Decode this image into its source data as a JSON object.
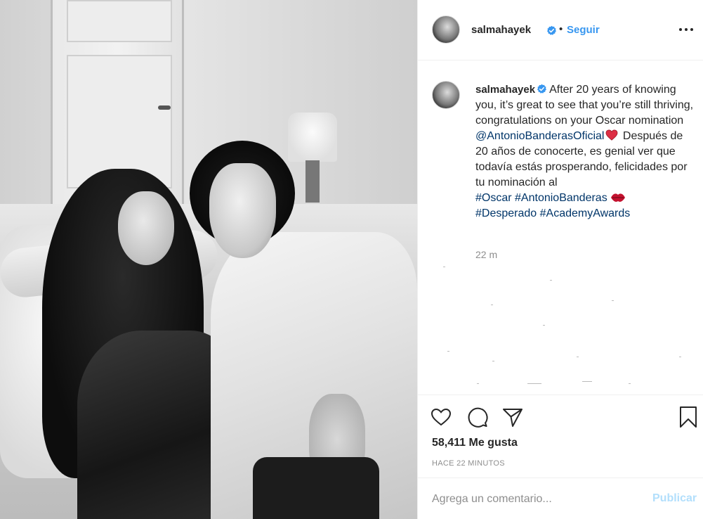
{
  "post": {
    "username": "salmahayek",
    "dot_separator": "•",
    "follow_label": "Seguir",
    "caption": {
      "username": "salmahayek",
      "text_1": "After 20 years of knowing you, it’s great to see that you’re still thriving, congratulations on your Oscar nomination",
      "mention": "@AntonioBanderasOficial",
      "text_2": "Después de 20 años de conocerte, es genial ver que todavía estás prosperando, felicidades por tu nominación al",
      "hashtags_line1": [
        "#Oscar",
        "#AntonioBanderas"
      ],
      "hashtags_line2": [
        "#Desperado",
        "#AcademyAwards"
      ],
      "emoji_1": "red-heart",
      "emoji_2": "kiss-mark"
    },
    "caption_time": "22 m",
    "likes": "58,411 Me gusta",
    "posted_time": "HACE 22 MINUTOS",
    "comment_placeholder": "Agrega un comentario...",
    "publish_label": "Publicar"
  },
  "icons": [
    "verified-badge-icon",
    "more-options-icon",
    "heart-icon",
    "comment-icon",
    "share-icon",
    "bookmark-icon"
  ],
  "colors": {
    "link": "#003569",
    "follow": "#3897f0",
    "verified": "#3897f0",
    "publish_disabled": "#b2dffc",
    "muted": "#8e8e8e",
    "text": "#262626"
  }
}
